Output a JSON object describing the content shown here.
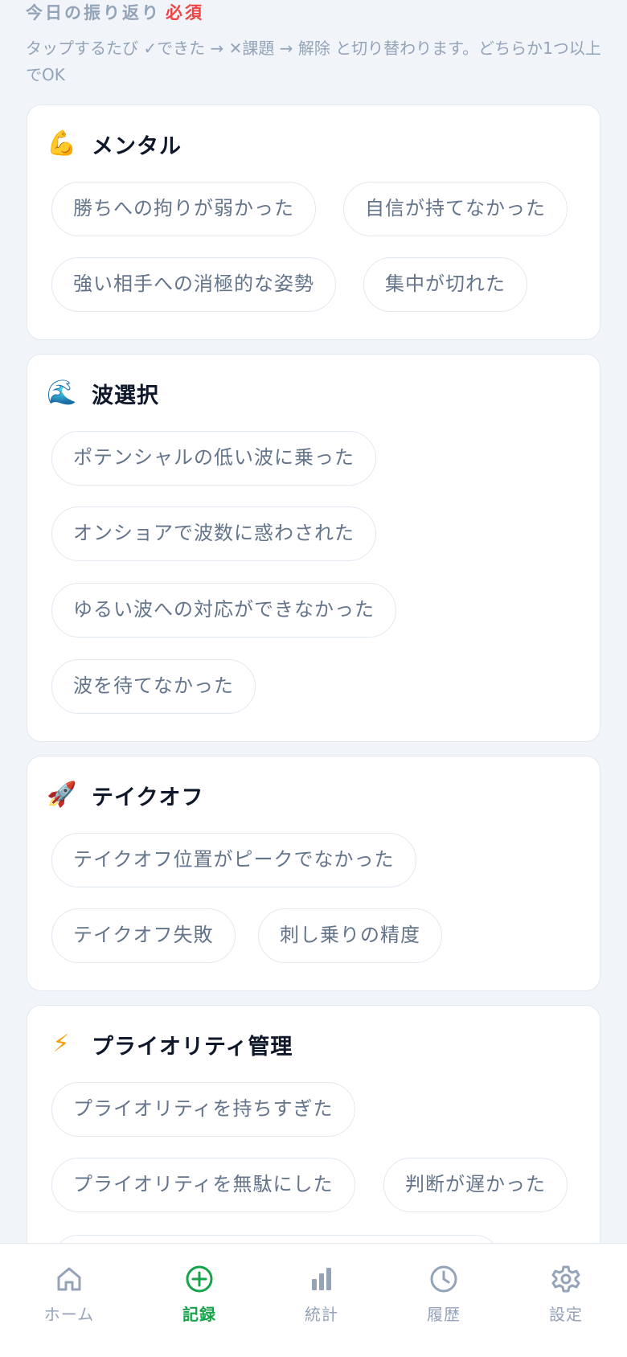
{
  "section": {
    "title": "今日の振り返り",
    "required": "必須",
    "description": "タップするたび ✓できた → ✕課題 → 解除 と切り替わります。どちらか1つ以上でOK"
  },
  "categories": [
    {
      "icon": "flexed-biceps-icon",
      "emoji": "💪",
      "name": "メンタル",
      "chips": [
        "勝ちへの拘りが弱かった",
        "自信が持てなかった",
        "強い相手への消極的な姿勢",
        "集中が切れた"
      ]
    },
    {
      "icon": "wave-icon",
      "emoji": "🌊",
      "name": "波選択",
      "chips": [
        "ポテンシャルの低い波に乗った",
        "オンショアで波数に惑わされた",
        "ゆるい波への対応ができなかった",
        "波を待てなかった"
      ]
    },
    {
      "icon": "rocket-icon",
      "emoji": "🚀",
      "name": "テイクオフ",
      "chips": [
        "テイクオフ位置がピークでなかった",
        "テイクオフ失敗",
        "刺し乗りの精度"
      ]
    },
    {
      "icon": "lightning-icon",
      "emoji": "⚡",
      "name": "プライオリティ管理",
      "chips": [
        "プライオリティを持ちすぎた",
        "プライオリティを無駄にした",
        "判断が遅かった"
      ]
    }
  ],
  "nav": {
    "items": [
      {
        "label": "ホーム",
        "icon": "home-icon"
      },
      {
        "label": "記録",
        "icon": "plus-circle-icon"
      },
      {
        "label": "統計",
        "icon": "bar-chart-icon"
      },
      {
        "label": "履歴",
        "icon": "clock-icon"
      },
      {
        "label": "設定",
        "icon": "gear-icon"
      }
    ],
    "active_color": "#16a34a",
    "inactive_color": "#94a3b8"
  }
}
